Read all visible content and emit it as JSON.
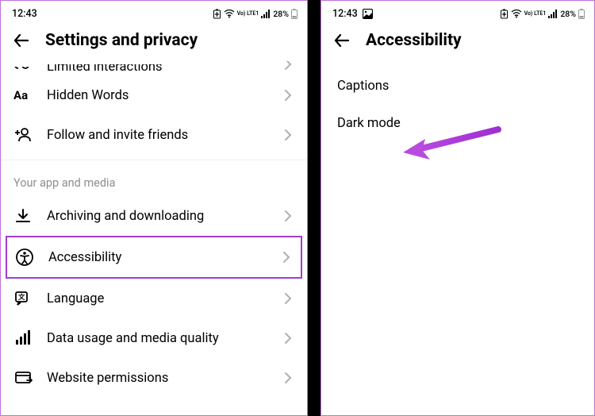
{
  "status": {
    "time": "12:43",
    "battery_pct": "28%",
    "lte_label": "Vo) LTE1"
  },
  "left": {
    "title": "Settings and privacy",
    "cutoff_label": "Limited interactions",
    "items_top": [
      {
        "label": "Hidden Words"
      },
      {
        "label": "Follow and invite friends"
      }
    ],
    "section": "Your app and media",
    "items_bottom": [
      {
        "label": "Archiving and downloading"
      },
      {
        "label": "Accessibility",
        "highlighted": true
      },
      {
        "label": "Language"
      },
      {
        "label": "Data usage and media quality"
      },
      {
        "label": "Website permissions"
      }
    ]
  },
  "right": {
    "title": "Accessibility",
    "items": [
      {
        "label": "Captions"
      },
      {
        "label": "Dark mode"
      }
    ]
  }
}
